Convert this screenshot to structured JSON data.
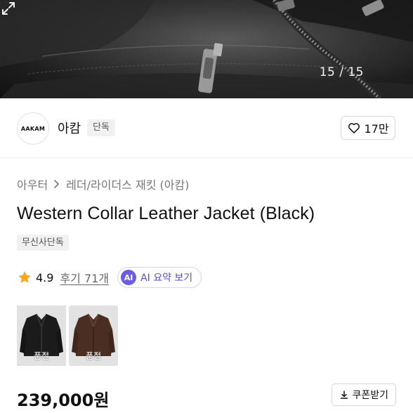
{
  "gallery": {
    "counter": "15 / 15",
    "expand_icon": "expand-icon"
  },
  "brand": {
    "logo_text": "AAKAM",
    "name": "아캄",
    "badge": "단독",
    "like_count": "17만"
  },
  "breadcrumb": {
    "category": "아우터",
    "subcategory": "레더/라이더스 재킷 (아캄)"
  },
  "product": {
    "title": "Western Collar Leather Jacket (Black)",
    "exclusive_tag": "무신사단독",
    "rating": "4.9",
    "reviews_label": "후기 71개",
    "ai_badge": "AI",
    "ai_summary_label": "AI 요약 보기",
    "price": "239,000원",
    "coupon_label": "쿠폰받기"
  },
  "variants": [
    {
      "status": "품절",
      "color": "#1b1b1b"
    },
    {
      "status": "품절",
      "color": "#4a2e22"
    }
  ],
  "colors": {
    "ai_accent": "#6b5ce7",
    "star": "#f5a623"
  }
}
